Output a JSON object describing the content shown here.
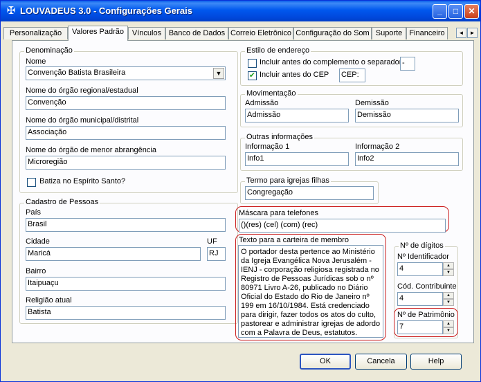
{
  "window": {
    "title": "LOUVADEUS 3.0 - Configurações Gerais"
  },
  "title_buttons": {
    "minimize": "_",
    "maximize": "□",
    "close": "✕"
  },
  "tabs": [
    {
      "label": "Personalização"
    },
    {
      "label": "Valores Padrão"
    },
    {
      "label": "Vínculos"
    },
    {
      "label": "Banco de Dados"
    },
    {
      "label": "Correio Eletrônico"
    },
    {
      "label": "Configuração do Som"
    },
    {
      "label": "Suporte"
    },
    {
      "label": "Financeiro"
    }
  ],
  "tab_scroll": {
    "left": "◄",
    "right": "►"
  },
  "denominacao": {
    "legend": "Denominação",
    "nome_label": "Nome",
    "nome_value": "Convenção Batista Brasileira",
    "regional_label": "Nome do órgão regional/estadual",
    "regional_value": "Convenção",
    "municipal_label": "Nome do órgão municipal/distrital",
    "municipal_value": "Associação",
    "menor_label": "Nome do órgão de menor abrangência",
    "menor_value": "Microregião",
    "batiza_label": "Batiza no Espírito Santo?",
    "batiza_checked": false
  },
  "cadastro": {
    "legend": "Cadastro de Pessoas",
    "pais_label": "País",
    "pais_value": "Brasil",
    "cidade_label": "Cidade",
    "cidade_value": "Maricá",
    "uf_label": "UF",
    "uf_value": "RJ",
    "bairro_label": "Bairro",
    "bairro_value": "Itaipuaçu",
    "religiao_label": "Religião atual",
    "religiao_value": "Batista"
  },
  "estilo": {
    "legend": "Estilo de endereço",
    "complemento_label": "Incluir antes do complemento o separador",
    "complemento_checked": false,
    "separador_value": "-",
    "cep_check_label": "Incluir antes do CEP",
    "cep_checked": true,
    "cep_value": "CEP:"
  },
  "movimentacao": {
    "legend": "Movimentação",
    "admissao_label": "Admissão",
    "admissao_value": "Admissão",
    "demissao_label": "Demissão",
    "demissao_value": "Demissão"
  },
  "outras": {
    "legend": "Outras informações",
    "info1_label": "Informação 1",
    "info1_value": "Info1",
    "info2_label": "Informação 2",
    "info2_value": "Info2"
  },
  "filhas": {
    "legend": "Termo para igrejas filhas",
    "value": "Congregação"
  },
  "mascara": {
    "legend": "Máscara para telefones",
    "value": "()(res) (cel) (com) (rec)"
  },
  "carteira": {
    "legend": "Texto para a carteira de membro",
    "text": "O portador desta pertence ao Ministério da Igreja Evangélica Nova Jerusalém - IENJ - corporação religiosa registrada no Registro de Pessoas Jurídicas sob o nº 80971 Livro A-26, publicado no Diário Oficial do Estado do Rio de Janeiro nº 199 em 16/10/1984. Está credenciado para dirigir, fazer todos os atos do culto, pastorear e administrar igrejas de adordo com a Palavra de Deus, estatutos."
  },
  "digitos": {
    "legend": "Nº de dígitos",
    "identificador_label": "Nº Identificador",
    "identificador_value": "4",
    "contribuinte_label": "Cód. Contribuinte",
    "contribuinte_value": "4",
    "patrimonio_label": "Nº de Patrimônio",
    "patrimonio_value": "7"
  },
  "spin": {
    "up": "▲",
    "down": "▼"
  },
  "buttons": {
    "ok": "OK",
    "cancel": "Cancela",
    "help": "Help"
  },
  "colors": {
    "title_bar": "#0058ee",
    "highlight_outline": "#cc2020",
    "window_bg": "#ece9d8"
  }
}
